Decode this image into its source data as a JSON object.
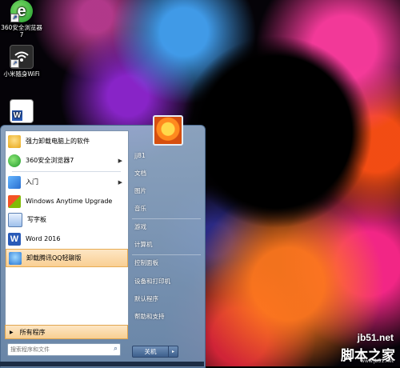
{
  "desktop": {
    "icons": [
      {
        "label": "360安全浏览器7",
        "icon": "360-browser-icon"
      },
      {
        "label": "小米随身WiFi",
        "icon": "wifi-icon"
      },
      {
        "label": "W",
        "icon": "word-document-icon"
      }
    ]
  },
  "start_menu": {
    "pinned": [
      {
        "label": "强力卸载电脑上的软件",
        "icon": "uninstall-icon"
      },
      {
        "label": "360安全浏览器7",
        "icon": "360-browser-icon",
        "submenu": true
      }
    ],
    "recent": [
      {
        "label": "入门",
        "icon": "getting-started-icon",
        "submenu": true
      },
      {
        "label": "Windows Anytime Upgrade",
        "icon": "windows-logo-icon"
      },
      {
        "label": "写字板",
        "icon": "wordpad-icon"
      },
      {
        "label": "Word 2016",
        "icon": "word-icon"
      },
      {
        "label": "卸载腾讯QQ轻聊版",
        "icon": "qq-uninstall-icon",
        "highlighted": true
      }
    ],
    "all_programs": "所有程序",
    "search_placeholder": "搜索程序和文件",
    "right_items": [
      {
        "label": "jj81"
      },
      {
        "label": "文档"
      },
      {
        "label": "图片"
      },
      {
        "label": "音乐"
      },
      {
        "label": "游戏"
      },
      {
        "label": "计算机"
      },
      {
        "label": "控制面板"
      },
      {
        "label": "设备和打印机"
      },
      {
        "label": "默认程序"
      },
      {
        "label": "帮助和支持"
      }
    ],
    "shutdown_label": "关机",
    "shutdown_arrow": "▸"
  },
  "watermark": {
    "site": "jb51.net",
    "logo": "脚本之家",
    "url": "www.jb51.net"
  }
}
